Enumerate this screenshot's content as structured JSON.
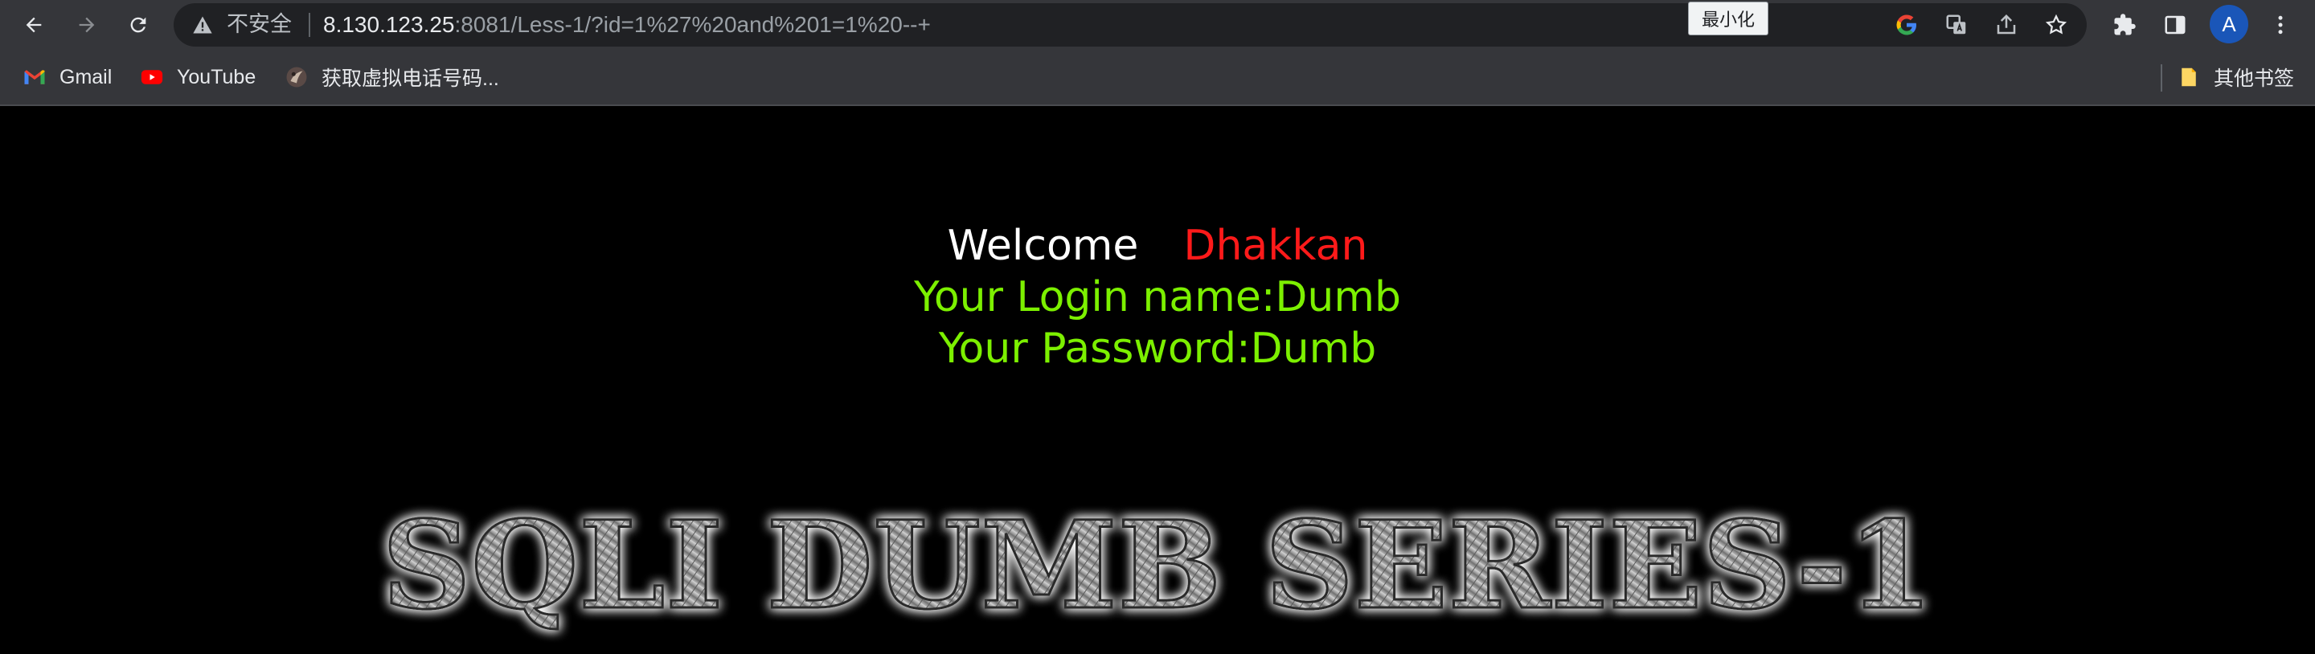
{
  "browser": {
    "omnibox": {
      "security_label": "不安全",
      "url_host": "8.130.123.25",
      "url_rest": ":8081/Less-1/?id=1%27%20and%201=1%20--+"
    },
    "tooltip": "最小化",
    "profile_initial": "A",
    "nav_icons": [
      "back-arrow-icon",
      "forward-arrow-icon",
      "reload-icon"
    ],
    "toolbar_icons": [
      "google-icon",
      "translate-icon",
      "share-icon",
      "star-icon",
      "extensions-icon",
      "side-panel-icon",
      "more-menu-icon"
    ]
  },
  "bookmarks": {
    "items": [
      {
        "label": "Gmail",
        "icon": "gmail-icon"
      },
      {
        "label": "YouTube",
        "icon": "youtube-icon"
      },
      {
        "label": "获取虚拟电话号码...",
        "icon": "site-favicon-icon"
      }
    ],
    "other": {
      "label": "其他书签",
      "icon": "folder-icon"
    }
  },
  "page": {
    "welcome_word": "Welcome",
    "welcome_name": "Dhakkan",
    "login_line": "Your Login name:Dumb",
    "password_line": "Your Password:Dumb",
    "banner_text": "SQLI DUMB SERIES-1"
  },
  "colors": {
    "chrome_toolbar": "#35363a",
    "omnibox": "#202124",
    "page_bg": "#000000",
    "welcome_name": "#ff1a1a",
    "credentials": "#7cf000"
  }
}
